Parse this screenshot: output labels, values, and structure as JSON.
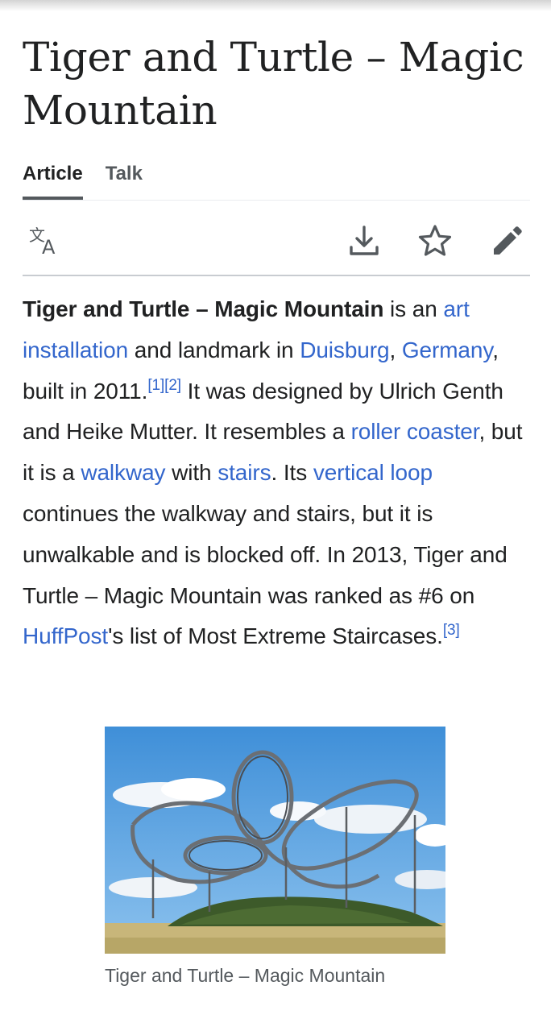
{
  "article": {
    "title": "Tiger and Turtle – Magic Mountain",
    "tabs": [
      {
        "label": "Article",
        "active": true
      },
      {
        "label": "Talk",
        "active": false
      }
    ]
  },
  "toolbar": {
    "icons": [
      "translate-icon",
      "download-icon",
      "star-icon",
      "edit-pencil-icon"
    ]
  },
  "paragraph": {
    "p1_bold": "Tiger and Turtle – Magic Mountain",
    "p2": " is an ",
    "link_art": "art installation",
    "p3": " and landmark in ",
    "link_duisburg": "Duisburg",
    "p4": ", ",
    "link_germany": "Germany",
    "p5": ", built in 2011.",
    "ref1": "[1]",
    "ref2": "[2]",
    "p6": " It was designed by Ulrich Genth and Heike Mutter. It resembles a ",
    "link_roller": "roller coaster",
    "p7": ", but it is a ",
    "link_walkway": "walkway",
    "p8": " with ",
    "link_stairs": "stairs",
    "p9": ". Its ",
    "link_loop": "vertical loop",
    "p10": " continues the walkway and stairs, but it is unwalkable and is blocked off. In 2013, Tiger and Turtle – Magic Mountain was ranked as #6 on ",
    "link_huffpost": "HuffPost",
    "p11": "'s list of Most Extreme Staircases.",
    "ref3": "[3]"
  },
  "figure": {
    "caption": "Tiger and Turtle – Magic Mountain"
  },
  "colors": {
    "link": "#3366cc",
    "text": "#202122",
    "secondary": "#54595d"
  }
}
